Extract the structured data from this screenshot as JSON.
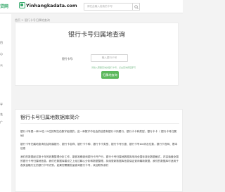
{
  "header": {
    "left_logo": "贷网",
    "brand": "Yinhangkadata.com",
    "search_placeholder": "请在此输入检索的卡号"
  },
  "sidebar": {
    "items": [
      "目",
      "心",
      "公",
      "平",
      "名",
      "广"
    ]
  },
  "breadcrumb": "首页 > 银行卡号归属地查询",
  "query_card": {
    "title": "银行卡号归属地查询",
    "input_label": "银行卡号:",
    "input_placeholder": "输入银行卡号",
    "hint": "请输入需要查询的银行卡号，点击查询按钮即可",
    "button": "归属地查询"
  },
  "intro_card": {
    "title": "银行卡号归属地数据库简介",
    "paragraphs": [
      "银行卡号是一串16位-19位的阿拉伯数字组成的，这一串数字中包含的信息有银行卡所属行，银行卡卡种类型，银行卡卡（ 银行卡号归属地）",
      "银行卡号归属地查询包括所属银行、银行卡名称、银行卡卡种、银行卡卡类型、银行卡号长度、银行卡号bin码及位数，银行卡官网、基本信息",
      "我们的数据经过数十年的收集整理分析工作，能够准确查询银行卡开户行，银行卡号归属地数据库采用全国标准化数据格式，内容涵盖全国的银行卡号归属地信息，我们在数据库建设之上经过精心分析和数据整理，持续更新数据库信息保证查询最新数据，我们的数据库可适用于各类金融行业的银行卡号识别，如果您需要批量查询银行卡号，欢迎联系我们"
    ]
  }
}
